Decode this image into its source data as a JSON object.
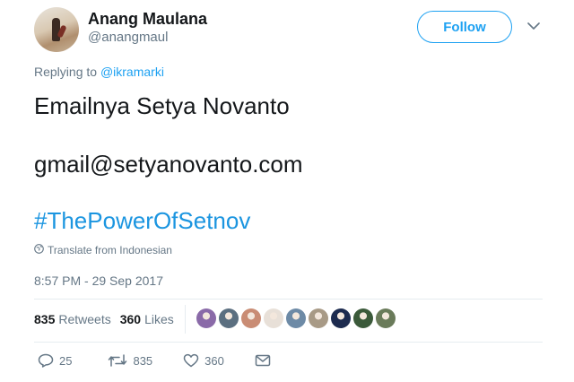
{
  "user": {
    "display_name": "Anang Maulana",
    "handle": "@anangmaul"
  },
  "header": {
    "follow_label": "Follow",
    "more_icon": "chevron-down-icon"
  },
  "reply": {
    "prefix": "Replying to ",
    "to_handle": "@ikramarki"
  },
  "tweet": {
    "line1": "Emailnya Setya Novanto",
    "line2": "gmail@setyanovanto.com",
    "hashtag": "#ThePowerOfSetnov"
  },
  "translate": {
    "label": "Translate from Indonesian",
    "icon": "globe-icon"
  },
  "timestamp": "8:57 PM - 29 Sep 2017",
  "stats": {
    "retweets_count": "835",
    "retweets_label": "Retweets",
    "likes_count": "360",
    "likes_label": "Likes"
  },
  "likers": [
    {
      "color": "#8a6aa8"
    },
    {
      "color": "#5b6f80"
    },
    {
      "color": "#c98c74"
    },
    {
      "color": "#e8e0d8"
    },
    {
      "color": "#6d8aa6"
    },
    {
      "color": "#a89a86"
    },
    {
      "color": "#1d2b4f"
    },
    {
      "color": "#3b5a3a"
    },
    {
      "color": "#6a7b5a"
    }
  ],
  "actions": {
    "reply_count": "25",
    "retweet_count": "835",
    "like_count": "360"
  },
  "colors": {
    "accent": "#1da1f2",
    "hashtag": "#1b95e0",
    "muted": "#657786",
    "divider": "#e6ecf0"
  }
}
